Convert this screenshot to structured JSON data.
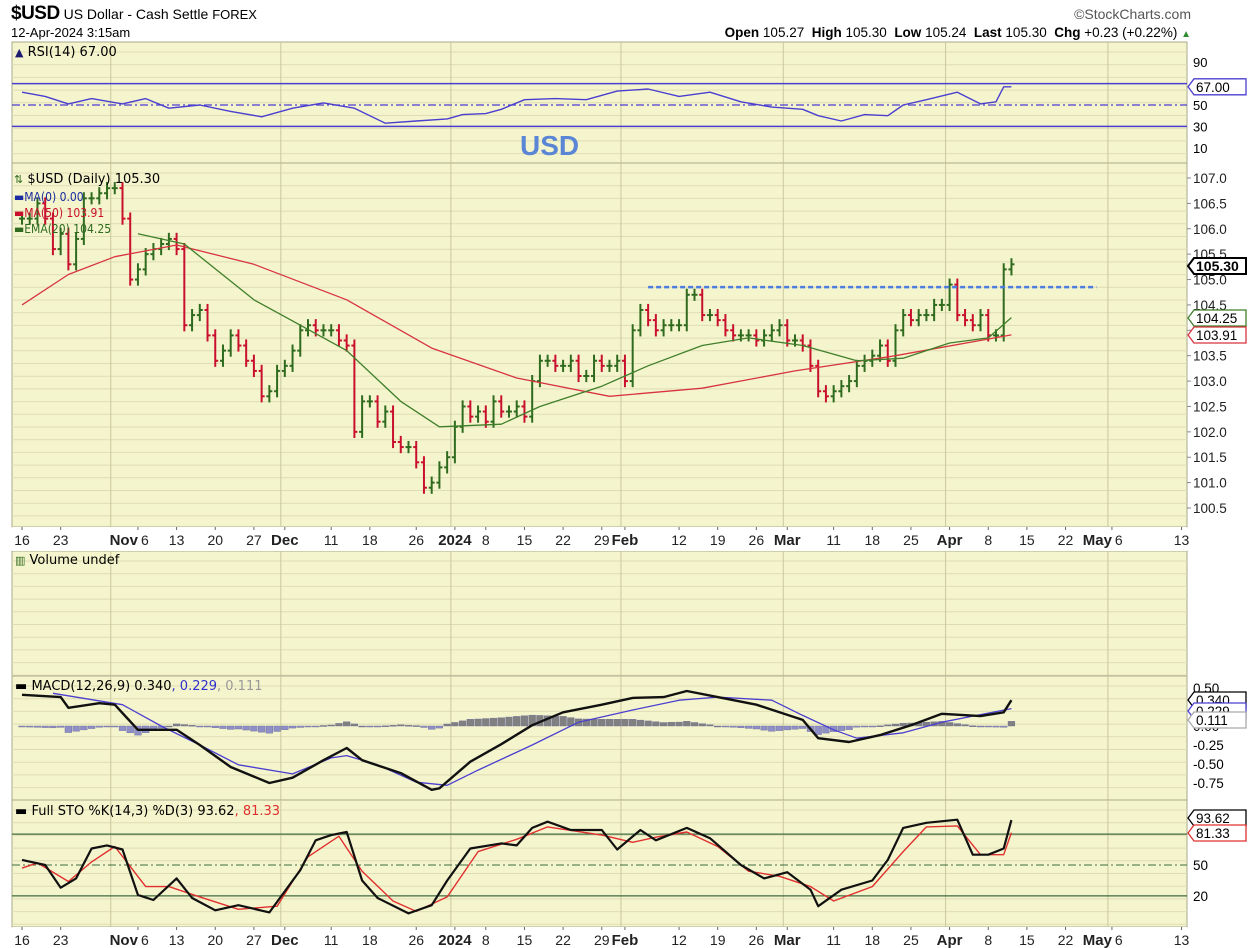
{
  "header": {
    "symbol": "$USD",
    "name": "US Dollar - Cash Settle",
    "exchange": "FOREX",
    "datetime": "12-Apr-2024 3:15am",
    "brand": "©StockCharts.com",
    "open_label": "Open",
    "open": "105.27",
    "high_label": "High",
    "high": "105.30",
    "low_label": "Low",
    "low": "105.24",
    "last_label": "Last",
    "last": "105.30",
    "chg_label": "Chg",
    "chg": "+0.23 (+0.22%)",
    "chg_icon": "up-triangle"
  },
  "annotation": "USD",
  "legends": {
    "rsi": "RSI(14) 67.00",
    "price": "$USD (Daily) 105.30",
    "ma0": "MA(0) 0.00",
    "ma50": "MA(50) 103.91",
    "ema20": "EMA(20) 104.25",
    "volume": "Volume undef",
    "macd_main": "MACD(12,26,9) 0.340",
    "macd_signal": ", 0.229",
    "macd_hist": ", 0.111",
    "sto_main": "Full STO %K(14,3) %D(3) 93.62",
    "sto_d": ", 81.33"
  },
  "colors": {
    "panel_bg": "#f5f5cd",
    "grid": "#dedcb4",
    "month_grid": "#c9c79c",
    "up": "#2f6b1f",
    "down": "#c8102e",
    "ma50": "#d8343f",
    "ema20": "#3f7f2a",
    "rsi": "#4b3fd0",
    "macd": "#111111",
    "signal": "#4b3fd0",
    "hist_neg": "#8f8fc8",
    "hist_pos": "#808080",
    "resistance": "#4a7be0",
    "sto_k": "#111111",
    "sto_d": "#e0302f",
    "sto_lines": "#3f6b3f"
  },
  "chart_data": {
    "type": "ohlc",
    "title": "$USD US Dollar - Cash Settle FOREX",
    "x_index_note": "trading-day index, 0 = 16 Oct 2023",
    "x_range": [
      -1,
      151
    ],
    "x_ticks": [
      {
        "idx": 0,
        "label": "16"
      },
      {
        "idx": 5,
        "label": "23"
      },
      {
        "idx": 15,
        "label": "Nov",
        "sub": "6"
      },
      {
        "idx": 20,
        "label": "13"
      },
      {
        "idx": 25,
        "label": "20"
      },
      {
        "idx": 30,
        "label": "27"
      },
      {
        "idx": 34,
        "label": "Dec"
      },
      {
        "idx": 40,
        "label": "11"
      },
      {
        "idx": 45,
        "label": "18"
      },
      {
        "idx": 51,
        "label": "26"
      },
      {
        "idx": 56,
        "label": "2024"
      },
      {
        "idx": 60,
        "label": "8"
      },
      {
        "idx": 65,
        "label": "15"
      },
      {
        "idx": 70,
        "label": "22"
      },
      {
        "idx": 75,
        "label": "29"
      },
      {
        "idx": 78,
        "label": "Feb"
      },
      {
        "idx": 85,
        "label": "12"
      },
      {
        "idx": 90,
        "label": "19"
      },
      {
        "idx": 95,
        "label": "26"
      },
      {
        "idx": 99,
        "label": "Mar"
      },
      {
        "idx": 105,
        "label": "11"
      },
      {
        "idx": 110,
        "label": "18"
      },
      {
        "idx": 115,
        "label": "25"
      },
      {
        "idx": 120,
        "label": "Apr"
      },
      {
        "idx": 125,
        "label": "8"
      },
      {
        "idx": 130,
        "label": "15"
      },
      {
        "idx": 135,
        "label": "22"
      },
      {
        "idx": 141,
        "label": "May",
        "sub": "6"
      },
      {
        "idx": 150,
        "label": "13"
      }
    ],
    "month_lines": [
      12,
      34,
      56,
      78,
      99,
      120,
      141
    ],
    "price": {
      "ylim": [
        100.2,
        107.3
      ],
      "y_ticks": [
        "107.0",
        "106.5",
        "106.0",
        "105.5",
        "105.0",
        "104.5",
        "104.0",
        "103.5",
        "103.0",
        "102.5",
        "102.0",
        "101.5",
        "101.0",
        "100.5"
      ],
      "close": [
        106.2,
        106.2,
        106.5,
        106.2,
        105.6,
        105.9,
        105.3,
        105.8,
        106.6,
        106.6,
        106.7,
        106.8,
        106.8,
        106.2,
        105.0,
        105.2,
        105.5,
        105.6,
        105.7,
        105.8,
        105.6,
        104.1,
        104.3,
        104.4,
        103.9,
        103.4,
        103.6,
        103.9,
        103.7,
        103.4,
        103.2,
        102.7,
        102.8,
        103.2,
        103.3,
        103.6,
        104.0,
        104.1,
        104.0,
        104.0,
        104.0,
        103.8,
        103.7,
        102.0,
        102.6,
        102.6,
        102.2,
        102.4,
        101.8,
        101.7,
        101.7,
        101.4,
        100.9,
        101.0,
        101.3,
        101.5,
        102.1,
        102.5,
        102.3,
        102.4,
        102.2,
        102.6,
        102.4,
        102.4,
        102.5,
        102.3,
        103.0,
        103.4,
        103.4,
        103.3,
        103.3,
        103.4,
        103.1,
        103.1,
        103.4,
        103.3,
        103.3,
        103.4,
        103.0,
        104.0,
        104.4,
        104.2,
        104.0,
        104.1,
        104.1,
        104.1,
        104.7,
        104.7,
        104.3,
        104.3,
        104.2,
        104.0,
        103.9,
        103.9,
        103.9,
        103.8,
        103.9,
        104.0,
        104.1,
        103.8,
        103.8,
        103.7,
        103.3,
        102.8,
        102.7,
        102.8,
        102.9,
        103.0,
        103.3,
        103.4,
        103.5,
        103.7,
        103.4,
        104.0,
        104.3,
        104.2,
        104.3,
        104.3,
        104.5,
        104.5,
        104.9,
        104.3,
        104.2,
        104.1,
        104.3,
        103.9,
        103.9,
        105.2,
        105.3
      ],
      "ma50": [
        [
          0,
          104.5
        ],
        [
          6,
          105.1
        ],
        [
          12,
          105.45
        ],
        [
          20,
          105.68
        ],
        [
          30,
          105.3
        ],
        [
          42,
          104.6
        ],
        [
          53,
          103.65
        ],
        [
          64,
          103.06
        ],
        [
          76,
          102.7
        ],
        [
          88,
          102.86
        ],
        [
          100,
          103.2
        ],
        [
          113,
          103.5
        ],
        [
          128,
          103.91
        ]
      ],
      "ema20": [
        [
          15,
          105.9
        ],
        [
          21,
          105.7
        ],
        [
          30,
          104.6
        ],
        [
          36,
          104.1
        ],
        [
          42,
          103.6
        ],
        [
          49,
          102.6
        ],
        [
          54,
          102.1
        ],
        [
          62,
          102.15
        ],
        [
          67,
          102.5
        ],
        [
          75,
          102.9
        ],
        [
          81,
          103.3
        ],
        [
          88,
          103.7
        ],
        [
          94,
          103.85
        ],
        [
          101,
          103.7
        ],
        [
          108,
          103.4
        ],
        [
          114,
          103.45
        ],
        [
          120,
          103.75
        ],
        [
          125,
          103.85
        ],
        [
          128,
          104.25
        ]
      ],
      "resistance": {
        "value": 104.85,
        "from_idx": 81,
        "to_idx": 139
      },
      "tags": [
        {
          "value": 105.3,
          "text": "105.30",
          "kind": "last"
        },
        {
          "value": 104.25,
          "text": "104.25",
          "kind": "ema"
        },
        {
          "value": 103.91,
          "text": "103.91",
          "kind": "ma"
        }
      ]
    },
    "rsi": {
      "ylim": [
        0,
        100
      ],
      "levels": [
        70,
        50,
        30
      ],
      "y_ticks": [
        "90",
        "50",
        "30",
        "10"
      ],
      "series": [
        [
          0,
          62
        ],
        [
          3,
          58
        ],
        [
          6,
          51
        ],
        [
          9,
          56
        ],
        [
          13,
          51
        ],
        [
          16,
          56
        ],
        [
          19,
          47
        ],
        [
          23,
          50
        ],
        [
          27,
          44
        ],
        [
          31,
          39
        ],
        [
          35,
          47
        ],
        [
          39,
          52
        ],
        [
          43,
          47
        ],
        [
          47,
          33
        ],
        [
          51,
          35
        ],
        [
          55,
          37
        ],
        [
          57,
          41
        ],
        [
          60,
          42
        ],
        [
          62,
          46
        ],
        [
          65,
          55
        ],
        [
          69,
          56
        ],
        [
          73,
          55
        ],
        [
          77,
          63
        ],
        [
          81,
          65
        ],
        [
          85,
          58
        ],
        [
          89,
          62
        ],
        [
          93,
          53
        ],
        [
          97,
          48
        ],
        [
          101,
          46
        ],
        [
          103,
          40
        ],
        [
          106,
          35
        ],
        [
          109,
          41
        ],
        [
          112,
          40
        ],
        [
          114,
          50
        ],
        [
          117,
          55
        ],
        [
          121,
          62
        ],
        [
          124,
          51
        ],
        [
          126,
          53
        ],
        [
          127,
          67
        ],
        [
          128,
          67
        ]
      ],
      "tag": "67.00",
      "tag_value": 67
    },
    "volume": {
      "values": []
    },
    "macd": {
      "y_ticks": [
        [
          "0.50",
          0.5
        ],
        [
          "0.00",
          0
        ],
        [
          "-0.25",
          -0.25
        ],
        [
          "-0.50",
          -0.5
        ],
        [
          "-0.75",
          -0.75
        ]
      ],
      "macd": [
        [
          0,
          0.41
        ],
        [
          5,
          0.38
        ],
        [
          6,
          0.24
        ],
        [
          10,
          0.3
        ],
        [
          12,
          0.28
        ],
        [
          15,
          -0.05
        ],
        [
          20,
          -0.05
        ],
        [
          23,
          -0.25
        ],
        [
          27,
          -0.54
        ],
        [
          32,
          -0.75
        ],
        [
          35,
          -0.68
        ],
        [
          39,
          -0.45
        ],
        [
          42,
          -0.29
        ],
        [
          44,
          -0.45
        ],
        [
          49,
          -0.62
        ],
        [
          53,
          -0.84
        ],
        [
          54,
          -0.82
        ],
        [
          58,
          -0.47
        ],
        [
          62,
          -0.24
        ],
        [
          66,
          0.01
        ],
        [
          70,
          0.18
        ],
        [
          75,
          0.28
        ],
        [
          79,
          0.37
        ],
        [
          83,
          0.38
        ],
        [
          86,
          0.46
        ],
        [
          90,
          0.38
        ],
        [
          95,
          0.28
        ],
        [
          101,
          0.08
        ],
        [
          103,
          -0.16
        ],
        [
          107,
          -0.21
        ],
        [
          111,
          -0.12
        ],
        [
          115,
          0.01
        ],
        [
          119,
          0.16
        ],
        [
          124,
          0.13
        ],
        [
          127,
          0.18
        ],
        [
          128,
          0.34
        ]
      ],
      "signal": [
        [
          4,
          0.43
        ],
        [
          13,
          0.28
        ],
        [
          18,
          0.0
        ],
        [
          23,
          -0.25
        ],
        [
          28,
          -0.51
        ],
        [
          35,
          -0.63
        ],
        [
          40,
          -0.42
        ],
        [
          42,
          -0.39
        ],
        [
          46,
          -0.51
        ],
        [
          51,
          -0.74
        ],
        [
          55,
          -0.78
        ],
        [
          59,
          -0.58
        ],
        [
          66,
          -0.25
        ],
        [
          72,
          0.05
        ],
        [
          79,
          0.21
        ],
        [
          85,
          0.34
        ],
        [
          90,
          0.38
        ],
        [
          97,
          0.34
        ],
        [
          101,
          0.14
        ],
        [
          105,
          -0.05
        ],
        [
          108,
          -0.16
        ],
        [
          114,
          -0.09
        ],
        [
          119,
          0.05
        ],
        [
          123,
          0.13
        ],
        [
          128,
          0.229
        ]
      ],
      "tags": [
        {
          "value": 0.34,
          "text": "0.340",
          "kind": "macd"
        },
        {
          "value": 0.229,
          "text": "0.229",
          "kind": "signal"
        },
        {
          "value": 0.111,
          "text": "0.111",
          "kind": "hist"
        }
      ]
    },
    "sto": {
      "ylim": [
        0,
        100
      ],
      "levels": [
        80,
        50,
        20
      ],
      "y_ticks": [
        [
          "50",
          50
        ],
        [
          "20",
          20
        ]
      ],
      "k": [
        [
          0,
          55
        ],
        [
          3,
          50
        ],
        [
          5,
          28
        ],
        [
          7,
          37
        ],
        [
          9,
          66
        ],
        [
          11,
          69
        ],
        [
          13,
          65
        ],
        [
          15,
          21
        ],
        [
          17,
          16
        ],
        [
          20,
          37
        ],
        [
          22,
          18
        ],
        [
          25,
          6
        ],
        [
          28,
          11
        ],
        [
          32,
          4
        ],
        [
          36,
          45
        ],
        [
          38,
          74
        ],
        [
          40,
          79
        ],
        [
          42,
          82
        ],
        [
          44,
          35
        ],
        [
          46,
          18
        ],
        [
          50,
          3
        ],
        [
          53,
          11
        ],
        [
          55,
          35
        ],
        [
          58,
          66
        ],
        [
          62,
          71
        ],
        [
          64,
          69
        ],
        [
          66,
          86
        ],
        [
          68,
          92
        ],
        [
          71,
          84
        ],
        [
          75,
          84
        ],
        [
          77,
          65
        ],
        [
          80,
          84
        ],
        [
          82,
          74
        ],
        [
          86,
          86
        ],
        [
          89,
          76
        ],
        [
          93,
          50
        ],
        [
          96,
          37
        ],
        [
          99,
          43
        ],
        [
          102,
          26
        ],
        [
          103,
          10
        ],
        [
          106,
          26
        ],
        [
          110,
          35
        ],
        [
          112,
          55
        ],
        [
          114,
          86
        ],
        [
          117,
          91
        ],
        [
          121,
          94
        ],
        [
          123,
          60
        ],
        [
          125,
          60
        ],
        [
          127,
          66
        ],
        [
          128,
          93.62
        ]
      ],
      "d": [
        [
          0,
          47
        ],
        [
          2,
          52
        ],
        [
          6,
          34
        ],
        [
          9,
          53
        ],
        [
          12,
          68
        ],
        [
          16,
          29
        ],
        [
          19,
          29
        ],
        [
          23,
          19
        ],
        [
          28,
          7
        ],
        [
          33,
          10
        ],
        [
          37,
          58
        ],
        [
          41,
          78
        ],
        [
          44,
          44
        ],
        [
          48,
          15
        ],
        [
          51,
          5
        ],
        [
          55,
          19
        ],
        [
          59,
          63
        ],
        [
          64,
          75
        ],
        [
          68,
          87
        ],
        [
          75,
          79
        ],
        [
          79,
          72
        ],
        [
          82,
          77
        ],
        [
          86,
          82
        ],
        [
          90,
          68
        ],
        [
          94,
          44
        ],
        [
          98,
          39
        ],
        [
          102,
          29
        ],
        [
          105,
          15
        ],
        [
          110,
          29
        ],
        [
          114,
          63
        ],
        [
          117,
          87
        ],
        [
          121,
          88
        ],
        [
          124,
          60
        ],
        [
          127,
          60
        ],
        [
          128,
          81.33
        ]
      ],
      "tags": [
        {
          "value": 93.62,
          "text": "93.62",
          "kind": "k"
        },
        {
          "value": 81.33,
          "text": "81.33",
          "kind": "d"
        }
      ]
    }
  }
}
